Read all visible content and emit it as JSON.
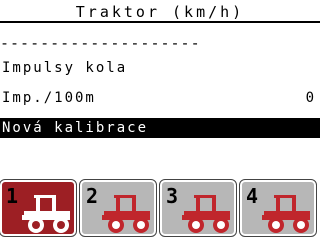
{
  "header": {
    "title": "Traktor (km/h)"
  },
  "separator": {
    "text": "--------------------"
  },
  "settings": {
    "wheel_impulses_label": "Impulsy kola",
    "imp_per_100m_label": "Imp./100m",
    "imp_per_100m_value": "0",
    "new_calibration_label": "Nová kalibrace"
  },
  "tractors": {
    "selected": "1",
    "items": [
      {
        "number": "1",
        "icon": "tractor-icon"
      },
      {
        "number": "2",
        "icon": "tractor-icon"
      },
      {
        "number": "3",
        "icon": "tractor-icon"
      },
      {
        "number": "4",
        "icon": "tractor-icon"
      }
    ]
  },
  "colors": {
    "selected_tile": "#9d1f24",
    "tile": "#b7b7b7",
    "tractor_body_active": "#ffffff",
    "tractor_body": "#c0262c"
  }
}
